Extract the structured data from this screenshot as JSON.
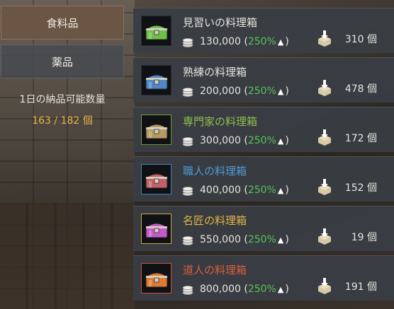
{
  "categories": [
    {
      "label": "食料品",
      "selected": true
    },
    {
      "label": "薬品",
      "selected": false
    }
  ],
  "quota": {
    "label": "1日の納品可能数量",
    "value": "163 / 182 個"
  },
  "boxes": [
    {
      "name": "見習いの料理箱",
      "name_color": "#e6e3dd",
      "border_color": "#2a2c31",
      "chest_color": "#6fbf4a",
      "price": "130,000",
      "percent": "250%",
      "qty": "310 個"
    },
    {
      "name": "熟練の料理箱",
      "name_color": "#e6e3dd",
      "border_color": "#2a2c31",
      "chest_color": "#4f86c4",
      "price": "200,000",
      "percent": "250%",
      "qty": "478 個"
    },
    {
      "name": "専門家の料理箱",
      "name_color": "#8fc04d",
      "border_color": "#6f9a3a",
      "chest_color": "#b59a62",
      "price": "300,000",
      "percent": "250%",
      "qty": "172 個"
    },
    {
      "name": "職人の料理箱",
      "name_color": "#4f9ad6",
      "border_color": "#3f7fb7",
      "chest_color": "#c2606a",
      "price": "400,000",
      "percent": "250%",
      "qty": "152 個"
    },
    {
      "name": "名匠の料理箱",
      "name_color": "#e5b545",
      "border_color": "#d1a53a",
      "chest_color": "#c25ac7",
      "price": "550,000",
      "percent": "250%",
      "qty": "19 個"
    },
    {
      "name": "道人の料理箱",
      "name_color": "#d9603b",
      "border_color": "#c9532f",
      "chest_color": "#de7a32",
      "price": "800,000",
      "percent": "250%",
      "qty": "191 個"
    }
  ],
  "icons": {
    "coin": "silver-coin-stack-icon",
    "delivery": "deliver-box-icon",
    "up": "up-triangle"
  }
}
